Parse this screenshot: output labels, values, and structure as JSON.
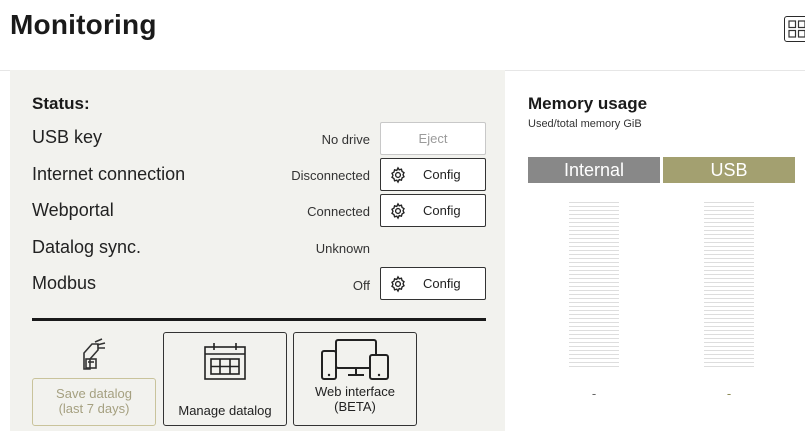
{
  "header": {
    "title": "Monitoring",
    "grid_icon": "grid-view-icon"
  },
  "status": {
    "heading": "Status:",
    "rows": [
      {
        "label": "USB key",
        "value": "No drive",
        "button": "Eject",
        "button_enabled": false
      },
      {
        "label": "Internet connection",
        "value": "Disconnected",
        "button": "Config",
        "button_enabled": true
      },
      {
        "label": "Webportal",
        "value": "Connected",
        "button": "Config",
        "button_enabled": true
      },
      {
        "label": "Datalog sync.",
        "value": "Unknown"
      },
      {
        "label": "Modbus",
        "value": "Off",
        "button": "Config",
        "button_enabled": true
      }
    ],
    "actions": {
      "save": {
        "line1": "Save datalog",
        "line2": "(last 7 days)",
        "icon": "usb-save-icon",
        "enabled": false
      },
      "manage": {
        "label": "Manage datalog",
        "icon": "calendar-table-icon"
      },
      "web": {
        "line1": "Web interface",
        "line2": "(BETA)",
        "icon": "devices-icon"
      }
    }
  },
  "memory": {
    "title": "Memory usage",
    "subtitle": "Used/total memory GiB",
    "internal": {
      "label": "Internal",
      "value": "-"
    },
    "usb": {
      "label": "USB",
      "value": "-"
    },
    "colors": {
      "internal": "#888888",
      "usb": "#a3a070"
    }
  }
}
